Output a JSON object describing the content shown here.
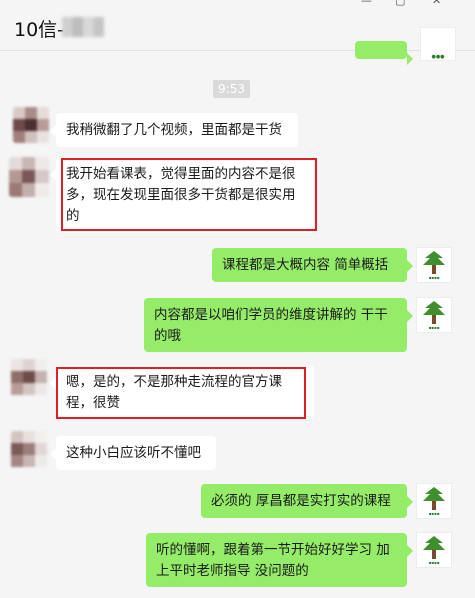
{
  "window": {
    "title": "10信-",
    "min_glyph": "—",
    "max_glyph": "▢",
    "close_glyph": "✕",
    "more_glyph": "•••"
  },
  "timestamp": "9:53",
  "messages": [
    {
      "side": "in",
      "text": "我稍微翻了几个视频，里面都是干货"
    },
    {
      "side": "in",
      "text": "我开始看课表，觉得里面的内容不是很多，现在发现里面很多干货都是很实用的",
      "highlight": true
    },
    {
      "side": "out",
      "text": "课程都是大概内容 简单概括"
    },
    {
      "side": "out",
      "text": "内容都是以咱们学员的维度讲解的 干干的哦"
    },
    {
      "side": "in",
      "text": "嗯，是的，不是那种走流程的官方课程，很赞",
      "highlight": true
    },
    {
      "side": "in",
      "text": "这种小白应该听不懂吧"
    },
    {
      "side": "out",
      "text": "必须的 厚昌都是实打实的课程"
    },
    {
      "side": "out",
      "text": "听的懂啊，跟着第一节开始好好学习 加上平时老师指导 没问题的"
    }
  ],
  "colors": {
    "background": "#f5f5f5",
    "bubble_in": "#ffffff",
    "bubble_out": "#95ec69",
    "highlight_border": "#e02020"
  }
}
